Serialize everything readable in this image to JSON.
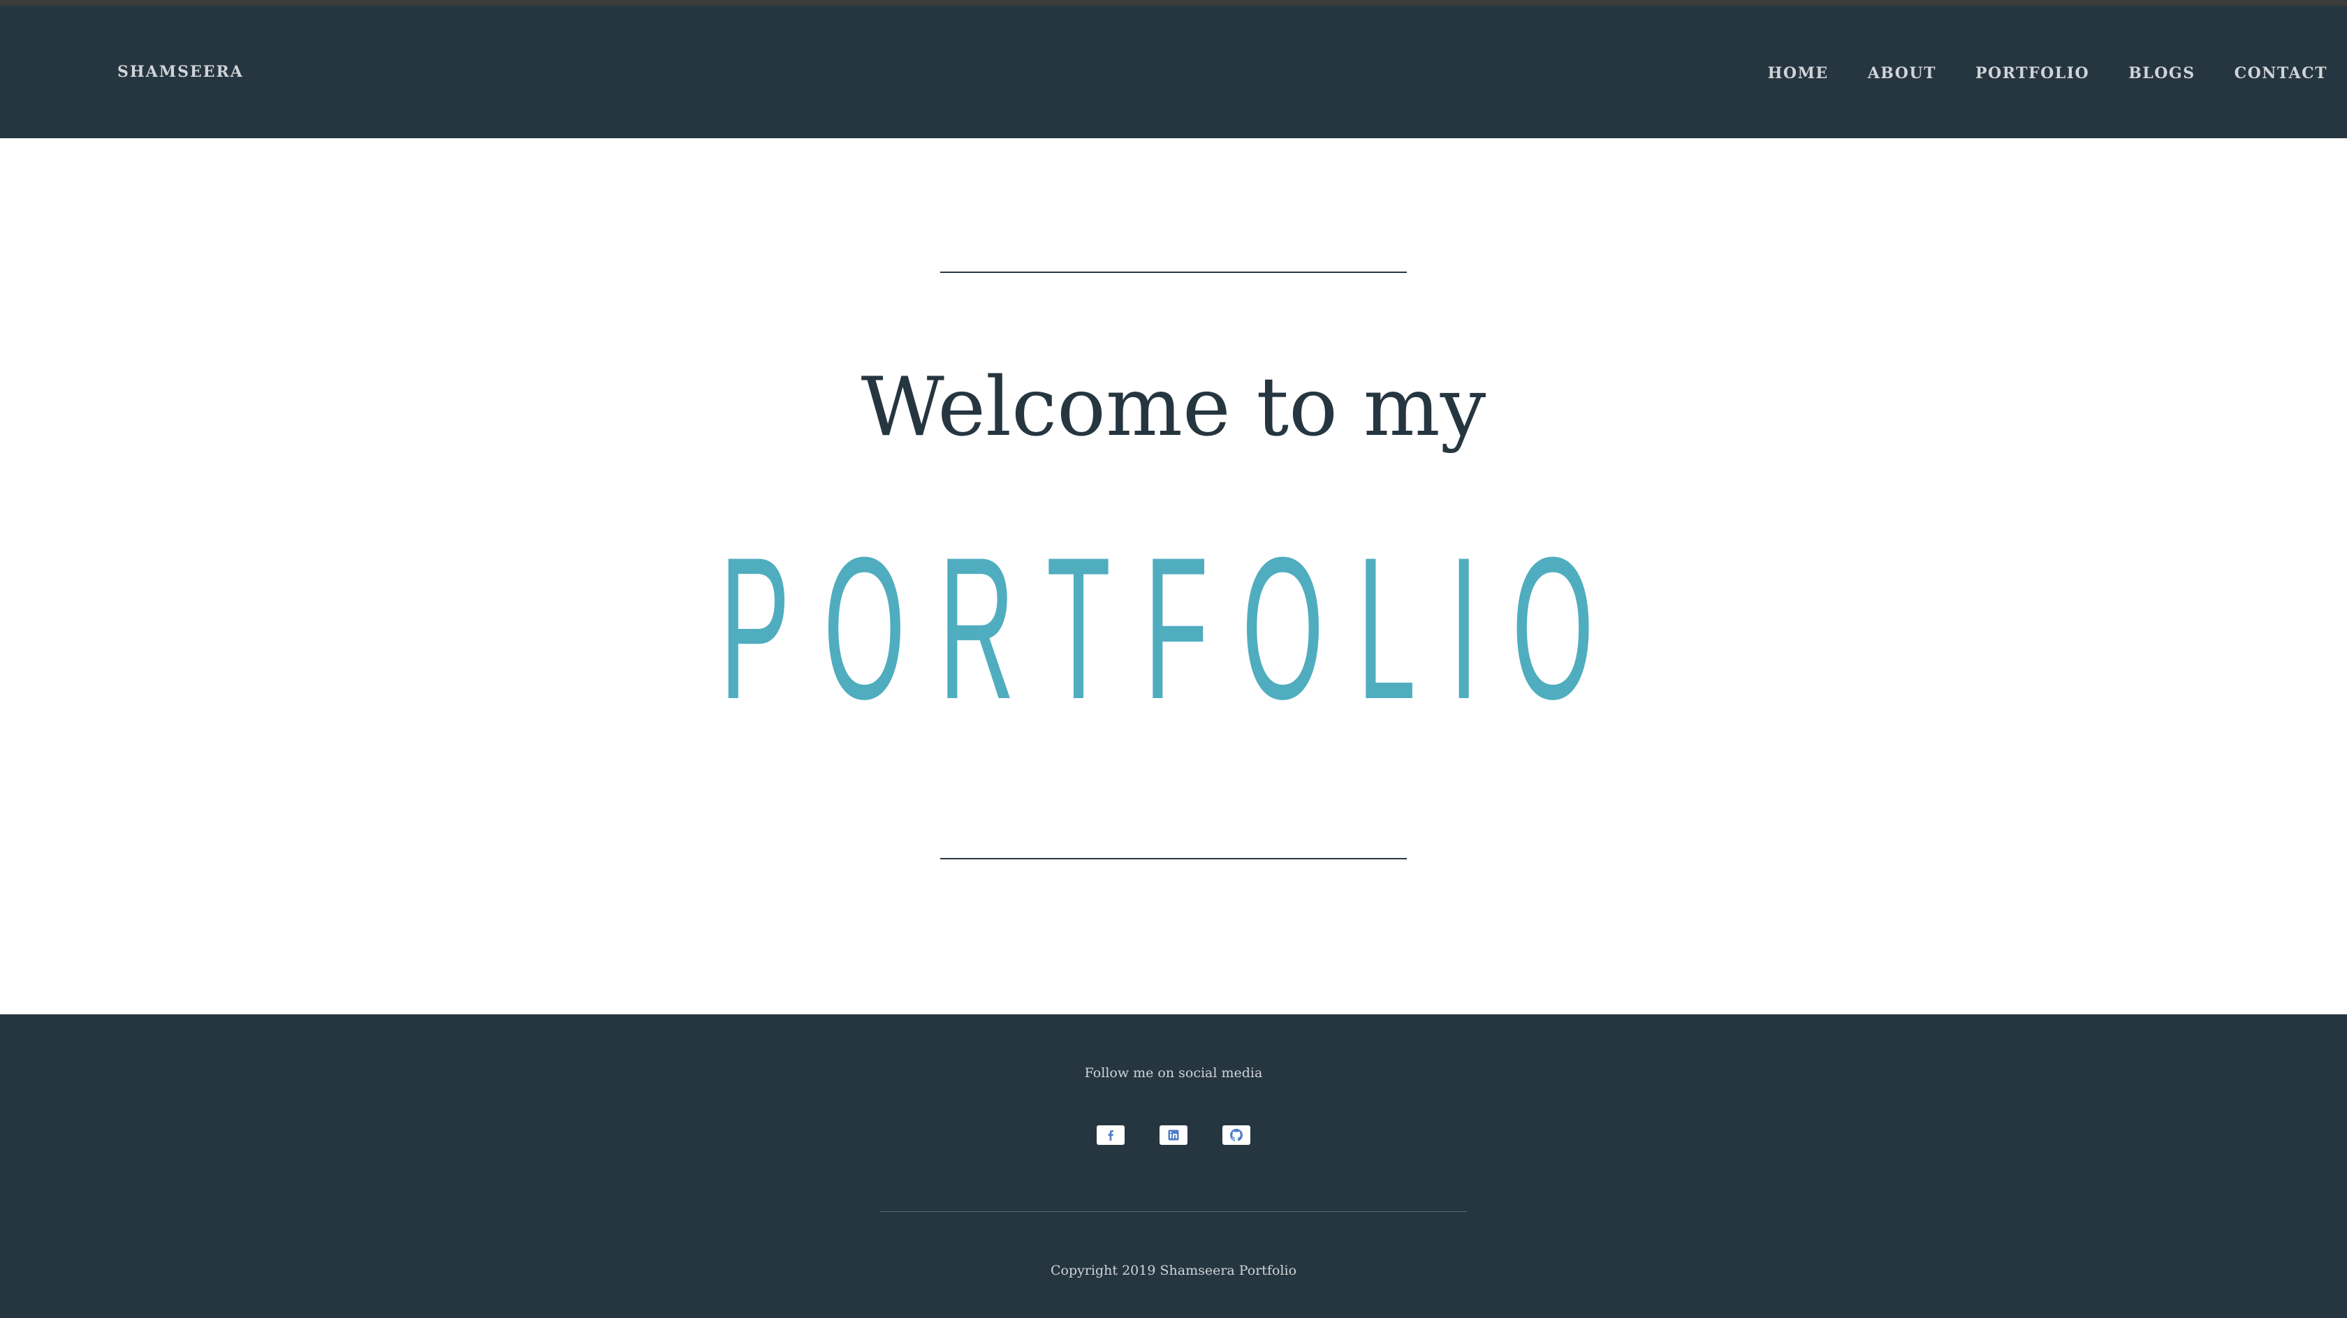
{
  "header": {
    "brand": "SHAMSEERA",
    "nav": [
      "HOME",
      "ABOUT",
      "PORTFOLIO",
      "BLOGS",
      "CONTACT"
    ]
  },
  "hero": {
    "welcome": "Welcome to my",
    "title": "PORTFOLIO"
  },
  "footer": {
    "follow_text": "Follow me on social media",
    "socials": [
      {
        "icon": "facebook-icon"
      },
      {
        "icon": "linkedin-icon"
      },
      {
        "icon": "github-icon"
      }
    ],
    "copyright": "Copyright 2019 Shamseera Portfolio"
  },
  "colors": {
    "dark": "#263640",
    "accent": "#4fadbf",
    "light_text": "#cfd4d8",
    "social_icon": "#4f7fc4"
  }
}
